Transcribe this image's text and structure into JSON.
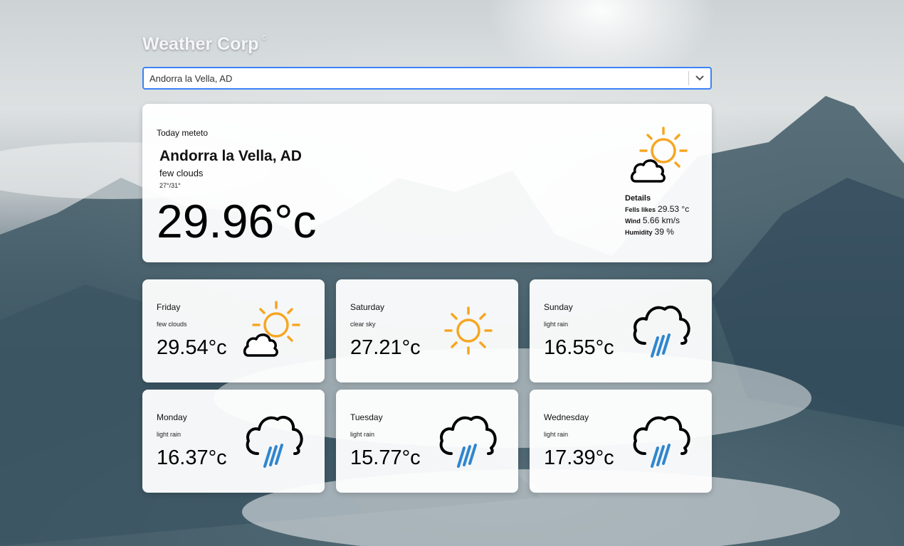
{
  "app": {
    "brand": "Weather Corp",
    "copyright_symbol": "©"
  },
  "search": {
    "selected_city": "Andorra la Vella, AD"
  },
  "today": {
    "label": "Today meteto",
    "city": "Andorra la Vella, AD",
    "description": "few clouds",
    "range": "27°/31°",
    "temperature": "29.96°c",
    "icon": "sun-cloud-icon",
    "details": {
      "title": "Details",
      "feels_like_label": "Fells likes",
      "feels_like_value": "29.53 °c",
      "wind_label": "Wind",
      "wind_value": "5.66 km/s",
      "humidity_label": "Humidity",
      "humidity_value": "39 %"
    }
  },
  "forecast": [
    {
      "day": "Friday",
      "description": "few clouds",
      "temperature": "29.54°c",
      "icon": "sun-cloud-icon"
    },
    {
      "day": "Saturday",
      "description": "clear sky",
      "temperature": "27.21°c",
      "icon": "sun-icon"
    },
    {
      "day": "Sunday",
      "description": "light rain",
      "temperature": "16.55°c",
      "icon": "rain-cloud-icon"
    },
    {
      "day": "Monday",
      "description": "light rain",
      "temperature": "16.37°c",
      "icon": "rain-cloud-icon"
    },
    {
      "day": "Tuesday",
      "description": "light rain",
      "temperature": "15.77°c",
      "icon": "rain-cloud-icon"
    },
    {
      "day": "Wednesday",
      "description": "light rain",
      "temperature": "17.39°c",
      "icon": "rain-cloud-icon"
    }
  ],
  "colors": {
    "sun": "#f6a623",
    "rain": "#2f86cf",
    "cloud_stroke": "#000000",
    "select_focus": "#3b82f6"
  }
}
